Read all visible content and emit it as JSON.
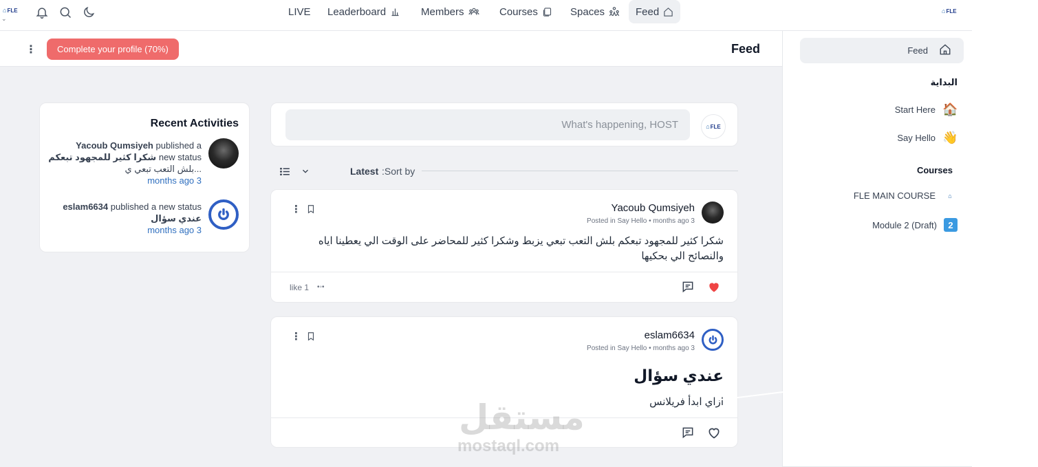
{
  "topbar": {
    "brand": "FLE",
    "nav": [
      {
        "label": "LIVE",
        "icon": ""
      },
      {
        "label": "Leaderboard",
        "icon": "bar-chart-icon"
      },
      {
        "label": "Members",
        "icon": "users-icon"
      },
      {
        "label": "Courses",
        "icon": "courses-icon"
      },
      {
        "label": "Spaces",
        "icon": "spaces-icon"
      },
      {
        "label": "Feed",
        "icon": "home-icon",
        "active": true
      }
    ]
  },
  "subheader": {
    "profile_button": "Complete your profile (70%)",
    "title": "Feed"
  },
  "composer": {
    "placeholder": "What's happening, HOST",
    "brand": "FLE"
  },
  "sort": {
    "label": ":Sort by",
    "value": "Latest"
  },
  "recent": {
    "title": "Recent Activities",
    "items": [
      {
        "user": "Yacoub Qumsiyeh",
        "action": "published a",
        "action2": "new status",
        "text": "شكرا كثير للمجهود تبعكم",
        "text2": "بلش التعب تبعي ي...",
        "time": "months ago 3"
      },
      {
        "user": "eslam6634",
        "action": "published a new status",
        "text": "عندي سؤال",
        "time": "months ago 3"
      }
    ]
  },
  "posts": [
    {
      "author": "Yacoub Qumsiyeh",
      "posted_in_label": "Posted in",
      "space": "Say Hello",
      "time": "months ago 3",
      "body_line1": "شكرا كثير للمجهود تبعكم بلش التعب تبعي يزبط وشكرا كثير للمحاضر على الوقت الي يعطينا اياه",
      "body_line2": "والنصائح الي بحكيها",
      "likes": "like 1"
    },
    {
      "author": "eslam6634",
      "posted_in_label": "Posted in",
      "space": "Say Hello",
      "time": "months ago 3",
      "title": "عندي سؤال",
      "body": "ازاي ابدأ فريلانس"
    }
  ],
  "sidebar": {
    "feed": "Feed",
    "section1": "البداية",
    "items1": [
      {
        "label": "Start Here",
        "icon": "house-emoji-icon"
      },
      {
        "label": "Say Hello",
        "icon": "wave-emoji-icon"
      }
    ],
    "section2": "Courses",
    "items2": [
      {
        "label": "FLE MAIN COURSE",
        "icon": "fle-logo-icon"
      },
      {
        "label": "Module 2 (Draft)",
        "icon": "number-2-icon"
      }
    ]
  },
  "watermark": {
    "arabic": "مستقل",
    "latin": "mostaql.com"
  },
  "colors": {
    "accent_red": "#ef6b6b",
    "heart": "#ef4444",
    "link": "#2f6fbf",
    "avatar_blue": "#2f5fc4"
  }
}
